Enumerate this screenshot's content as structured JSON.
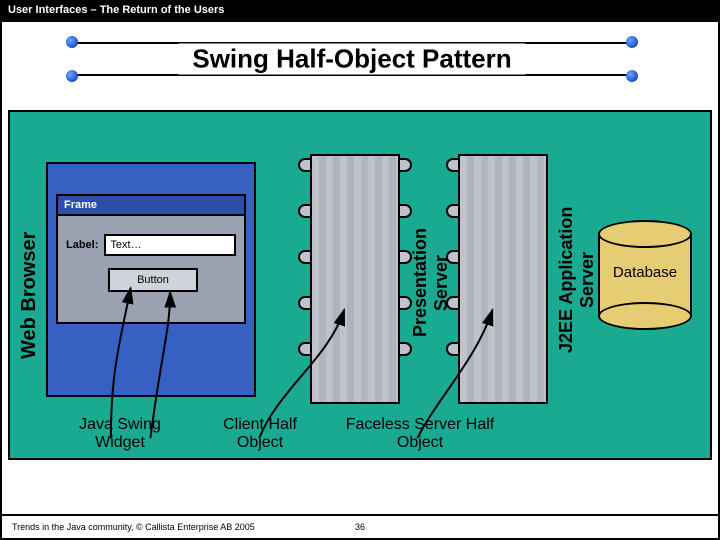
{
  "topbar": "User Interfaces – The Return of the Users",
  "title": "Swing Half-Object Pattern",
  "labels": {
    "web_browser": "Web Browser",
    "presentation_server": "Presentation\nServer",
    "j2ee_app_server": "J2EE Application\nServer",
    "database": "Database"
  },
  "frame": {
    "title": "Frame",
    "label": "Label:",
    "text_placeholder": "Text…",
    "button": "Button"
  },
  "captions": {
    "java_swing_widget": "Java Swing Widget",
    "client_half_object": "Client Half Object",
    "faceless_server_half_object": "Faceless Server Half Object"
  },
  "footer": {
    "copyright": "Trends in the Java community, © Callista Enterprise AB 2005",
    "page": "36"
  }
}
